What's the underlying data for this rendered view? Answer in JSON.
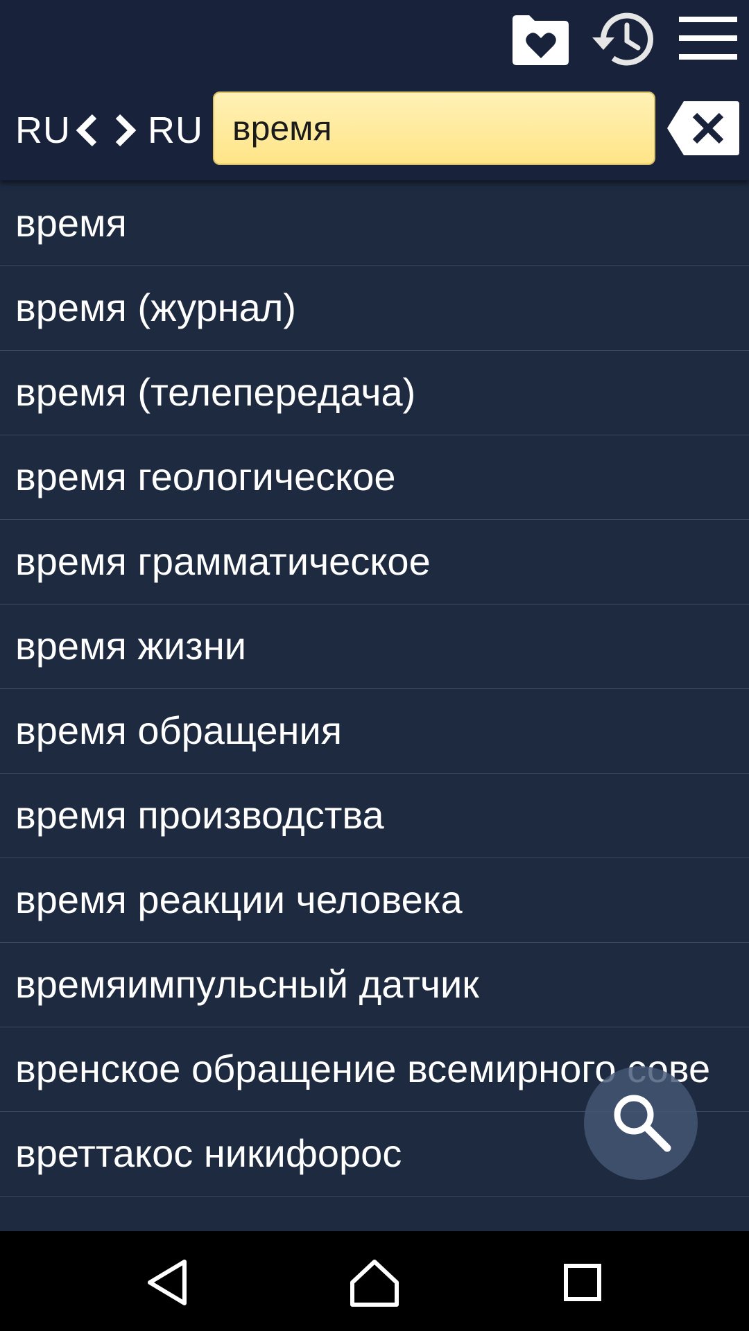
{
  "toolbar": {
    "icons": [
      "favorites-folder-icon",
      "history-icon",
      "menu-icon"
    ],
    "source_language": "RU",
    "target_language": "RU",
    "search_value": "время",
    "clear_icon": "backspace-clear-icon"
  },
  "results": [
    "время",
    "время (журнал)",
    "время (телепередача)",
    "время геологическое",
    "время грамматическое",
    "время жизни",
    "время обращения",
    "время производства",
    "время реакции человека",
    "времяимпульсный датчик",
    "вренское обращение всемирного сове",
    "вреттакос никифорос"
  ],
  "fab_icon": "search-icon",
  "navbar": {
    "icons": [
      "back-icon",
      "home-icon",
      "recent-apps-icon"
    ]
  },
  "colors": {
    "toolbar_bg": "#18223a",
    "list_bg": "#1e2a40",
    "search_bg": "#ffe99a",
    "divider": "#3e4b63"
  }
}
